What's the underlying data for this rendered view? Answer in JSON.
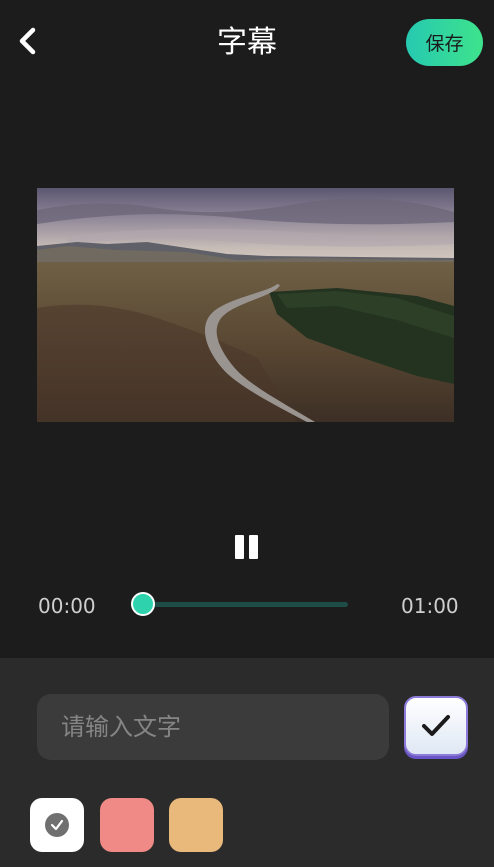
{
  "header": {
    "back_icon": "chevron-left-icon",
    "title": "字幕",
    "save_label": "保存"
  },
  "player": {
    "play_state_icon": "pause-icon",
    "current_time": "00:00",
    "total_time": "01:00",
    "progress": 0
  },
  "editor": {
    "input_placeholder": "请输入文字",
    "input_value": "",
    "confirm_icon": "check-icon"
  },
  "colors": {
    "accent": "#2ed3ae",
    "swatches": [
      {
        "name": "white",
        "hex": "#ffffff",
        "selected": true
      },
      {
        "name": "pink",
        "hex": "#f08a86",
        "selected": false
      },
      {
        "name": "orange",
        "hex": "#e9b97b",
        "selected": false
      }
    ]
  }
}
